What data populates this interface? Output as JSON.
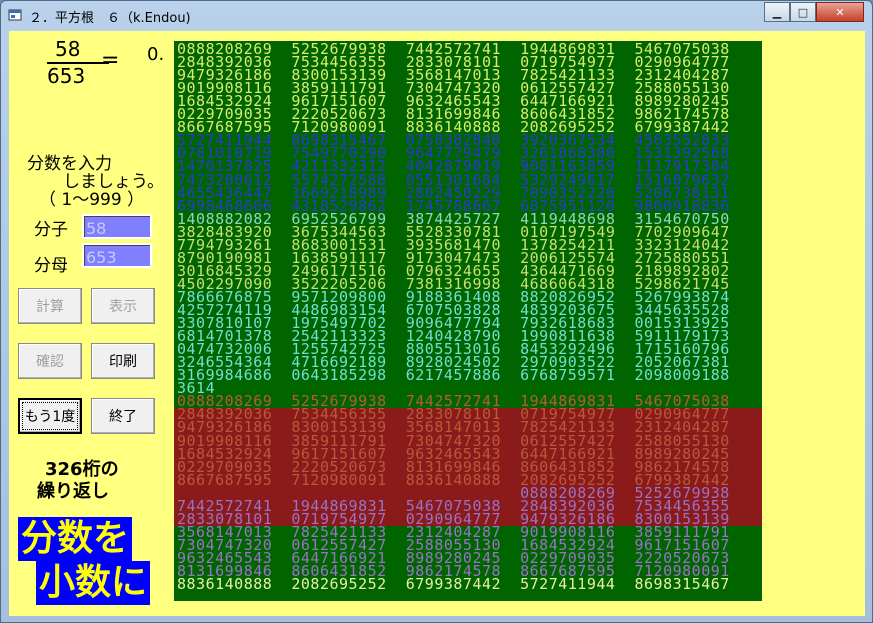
{
  "window": {
    "title": "２．平方根　６（k.Endou)",
    "minimize": "▁",
    "maximize": "□",
    "close": "✕"
  },
  "fraction": {
    "numerator": "58",
    "denominator": "653",
    "equals": "=",
    "prefix": "0."
  },
  "prompt": {
    "line1": "分数を入力",
    "line2": "しましょう。",
    "line3": "（ 1〜999 ）"
  },
  "fields": {
    "numerator_label": "分子",
    "numerator_value": "58",
    "denominator_label": "分母",
    "denominator_value": "653"
  },
  "buttons": {
    "calc": "計算",
    "show": "表示",
    "confirm": "確認",
    "print": "印刷",
    "again": "もう1度",
    "end": "終了"
  },
  "repeat_info": {
    "line1": "326桁の",
    "line2": "繰り返し"
  },
  "banner": {
    "line1": "分数を",
    "line2": "小数に"
  },
  "colors": {
    "panel": "#006400",
    "highlight_band": "#8b1a1a",
    "digits_a": "#cfe860",
    "digits_b": "#2030c0",
    "digits_c": "#70e0d0"
  },
  "rows": [
    {
      "text": "0888208269  5252679938  7442572741  1944869831  5467075038",
      "color": "#d8ec70"
    },
    {
      "text": "2848392036  7534456355  2833078101  0719754977  0290964777",
      "color": "#d8ec70"
    },
    {
      "text": "9479326186  8300153139  3568147013  7825421133  2312404287",
      "color": "#d8ec70"
    },
    {
      "text": "9019908116  3859111791  7304747320  0612557427  2588055130",
      "color": "#d8ec70"
    },
    {
      "text": "1684532924  9617151607  9632465543  6447166921  8989280245",
      "color": "#d8ec70"
    },
    {
      "text": "0229709035  2220520673  8131699846  8606431852  9862174578",
      "color": "#d8ec70"
    },
    {
      "text": "8667687595  7120980091  8836140888  2082695252  6799387442",
      "color": "#d8ec70"
    },
    {
      "text": "5727411944  8698315467  0750382848  3920367534  4563552833",
      "color": "#2a3ad0"
    },
    {
      "text": "0781010719  7549770290  9647779479  3261868300  1531392568",
      "color": "#2a3ad0"
    },
    {
      "text": "1470137825  4211332312  4042879019  9081163859  1117917304",
      "color": "#2a3ad0"
    },
    {
      "text": "7473200612  5574272588  0551301684  5329249617  1516079632",
      "color": "#2a3ad0"
    },
    {
      "text": "4655436447  1669218989  2802450229  7090352220  5206738131",
      "color": "#2a3ad0"
    },
    {
      "text": "6998468606  4318529862  1745788667  6875951120  9800918836",
      "color": "#2a3ad0"
    },
    {
      "text": "1408882082  6952526799  3874425727  4119448698  3154670750",
      "color": "#8fd8b8"
    },
    {
      "text": "3828483920  3675344563  5528330781  0107197549  7702909647",
      "color": "#c8e070"
    },
    {
      "text": "7794793261  8683001531  3935681470  1378254211  3323124042",
      "color": "#c8e070"
    },
    {
      "text": "8790190981  1638591117  9173047473  2006125574  2725880551",
      "color": "#c8e070"
    },
    {
      "text": "3016845329  2496171516  0796324655  4364471669  2189892802",
      "color": "#c8e070"
    },
    {
      "text": "4502297090  3522205206  7381316998  4686064318  5298621745",
      "color": "#c8e070"
    },
    {
      "text": "7866676875  9571209800  9188361408  8820826952  5267993874",
      "color": "#70e0d0"
    },
    {
      "text": "4257274119  4486983154  6707503828  4839203675  3445635528",
      "color": "#70e0d0"
    },
    {
      "text": "3307810107  1975497702  9096477794  7932618683  0015313925",
      "color": "#70e0d0"
    },
    {
      "text": "6814701378  2542113323  1240428790  1990811638  5911179173",
      "color": "#70e0d0"
    },
    {
      "text": "0474732006  1255742725  8805513016  8453292496  1715160796",
      "color": "#70e0d0"
    },
    {
      "text": "3246554364  4716692189  8928024502  2970903522  2052067381",
      "color": "#70e0d0"
    },
    {
      "text": "3169984686  0643185298  6217457886  6768759571  2098009188",
      "color": "#70e0d0"
    },
    {
      "text": "3614",
      "color": "#70e0d0"
    },
    {
      "text": "0888208269  5252679938  7442572741  1944869831  5467075038",
      "color": "#b85a3a"
    },
    {
      "text": "2848392036  7534456355  2833078101  0719754977  0290964777",
      "color": "#b85a3a"
    },
    {
      "text": "9479326186  8300153139  3568147013  7825421133  2312404287",
      "color": "#b85a3a"
    },
    {
      "text": "9019908116  3859111791  7304747320  0612557427  2588055130",
      "color": "#b85a3a"
    },
    {
      "text": "1684532924  9617151607  9632465543  6447166921  8989280245",
      "color": "#b85a3a"
    },
    {
      "text": "0229709035  2220520673  8131699846  8606431852  9862174578",
      "color": "#b85a3a"
    },
    {
      "text": "8667687595  7120980091  8836140888  2082695252  6799387442",
      "color": "#b85a3a"
    },
    {
      "text": "                                    0888208269  5252679938",
      "color": "#9a72c8"
    },
    {
      "text": "7442572741  1944869831  5467075038  2848392036  7534456355",
      "color": "#9a72c8"
    },
    {
      "text": "2833078101  0719754977  0290964777  9479326186  8300153139",
      "color": "#9a72c8"
    },
    {
      "text": "3568147013  7825421133  2312404287  9019908116  3859111791",
      "color": "#9a72c8"
    },
    {
      "text": "7304747320  0612557427  2588055130  1684532924  9617151607",
      "color": "#9a72c8"
    },
    {
      "text": "9632465543  6447166921  8989280245  0229709035  2220520673",
      "color": "#9a72c8"
    },
    {
      "text": "8131699846  8606431852  9862174578  8667687595  7120980091",
      "color": "#9a72c8"
    },
    {
      "text": "8836140888  2082695252  6799387442  5727411944  8698315467",
      "color": "#e8f0a0"
    }
  ]
}
